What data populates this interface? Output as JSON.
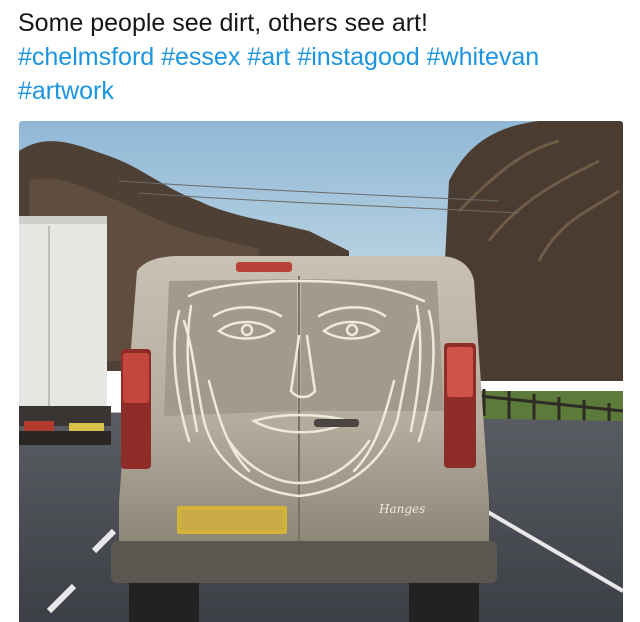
{
  "tweet": {
    "text": "Some people see dirt, others see art!",
    "hashtags": [
      "#chelmsford",
      "#essex",
      "#art",
      "#instagood",
      "#whitevan",
      "#artwork"
    ]
  },
  "photo": {
    "subject": "dirt-art-face-on-white-van",
    "van_signature": "Hanges",
    "colors": {
      "sky": "#9fc3dc",
      "road": "#4c4f55",
      "van": "#b9b0a2",
      "trees": "#5a4a3c"
    }
  }
}
